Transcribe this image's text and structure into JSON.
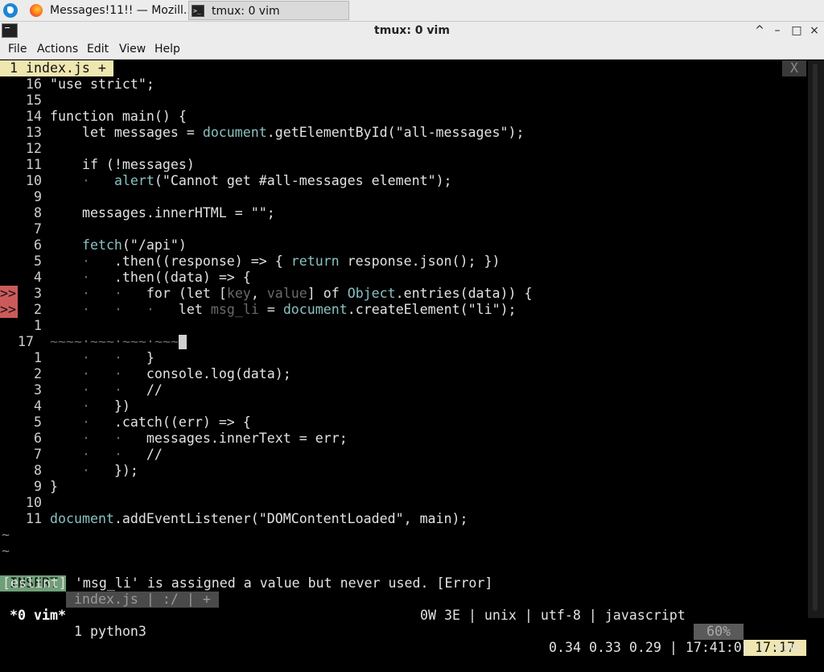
{
  "taskbar": {
    "tasks": [
      {
        "label": "Messages!11!! — Mozill..."
      },
      {
        "label": "tmux: 0 vim"
      }
    ]
  },
  "window": {
    "title": "tmux: 0 vim",
    "controls": [
      "^",
      "–",
      "□",
      "×"
    ]
  },
  "menu": [
    "File",
    "Actions",
    "Edit",
    "View",
    "Help"
  ],
  "vim": {
    "tab_label": "1 index.js +",
    "tab_close": "X",
    "lines": [
      {
        "num": "16",
        "text": "\"use strict\";"
      },
      {
        "num": "15",
        "text": ""
      },
      {
        "num": "14",
        "text": "function main() {"
      },
      {
        "num": "13",
        "text": "    let messages = document.getElementById(\"all-messages\");"
      },
      {
        "num": "12",
        "text": ""
      },
      {
        "num": "11",
        "text": "    if (!messages)"
      },
      {
        "num": "10",
        "text": "    ·   alert(\"Cannot get #all-messages element\");"
      },
      {
        "num": "9",
        "text": ""
      },
      {
        "num": "8",
        "text": "    messages.innerHTML = \"\";"
      },
      {
        "num": "7",
        "text": ""
      },
      {
        "num": "6",
        "text": "    fetch(\"/api\")"
      },
      {
        "num": "5",
        "text": "    ·   .then((response) => { return response.json(); })"
      },
      {
        "num": "4",
        "text": "    ·   .then((data) => {"
      },
      {
        "num": "3",
        "text": "    ·   ·   for (let [key, value] of Object.entries(data)) {",
        "sign": ">>"
      },
      {
        "num": "2",
        "text": "    ·   ·   ·   let msg_li = document.createElement(\"li\");",
        "sign": ">>"
      },
      {
        "num": "1",
        "text": ""
      },
      {
        "num": "17",
        "text": "~~~~·~~~·~~~·~~~"
      },
      {
        "num": "1",
        "text": "    ·   ·   }"
      },
      {
        "num": "2",
        "text": "    ·   ·   console.log(data);"
      },
      {
        "num": "3",
        "text": "    ·   ·   //"
      },
      {
        "num": "4",
        "text": "    ·   })"
      },
      {
        "num": "5",
        "text": "    ·   .catch((err) => {"
      },
      {
        "num": "6",
        "text": "    ·   ·   messages.innerText = err;"
      },
      {
        "num": "7",
        "text": "    ·   ·   //"
      },
      {
        "num": "8",
        "text": "    ·   });"
      },
      {
        "num": "9",
        "text": "}"
      },
      {
        "num": "10",
        "text": ""
      },
      {
        "num": "11",
        "text": "document.addEventListener(\"DOMContentLoaded\", main);"
      }
    ],
    "tildes": [
      "~",
      "~"
    ],
    "status": {
      "mode": "INSERT",
      "file": "index.js | :/ | +",
      "info": "0W 3E | unix | utf-8 | javascript",
      "percent": "60%",
      "position": "17:17"
    },
    "message": "[eslint] 'msg_li' is assigned a value but never used. [Error]"
  },
  "tmux": {
    "window_active": "*0 vim*",
    "window_other": "1 python3",
    "right": "0.34 0.33 0.29 | 17:41:01 | vim"
  },
  "colors": {
    "accent_tab": "#efe6b0",
    "mode_bg": "#6f9f78",
    "sign_bg": "#cc5a5a",
    "function_color": "#8ac0c2",
    "paren_color": "#c55bc0"
  }
}
